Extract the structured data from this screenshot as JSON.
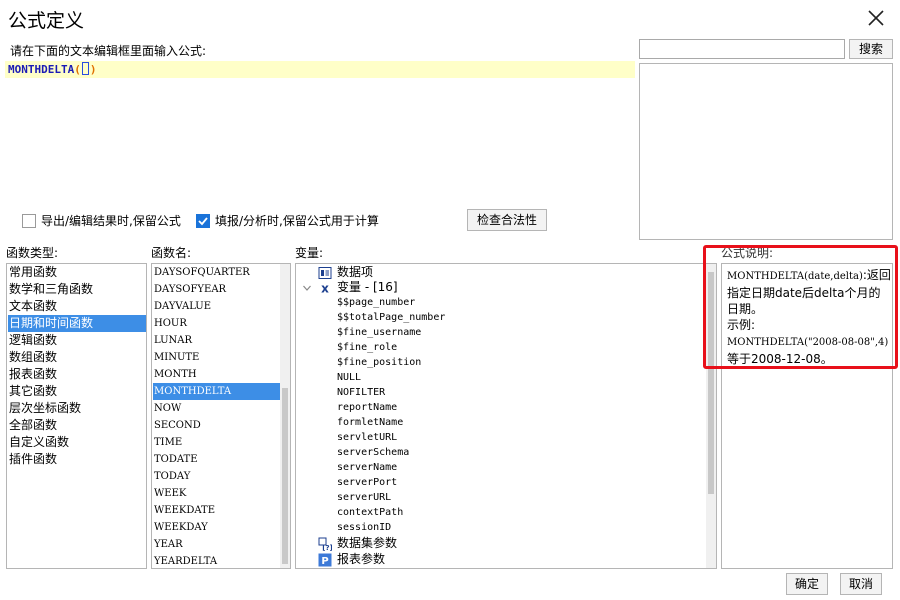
{
  "window": {
    "title": "公式定义"
  },
  "editor": {
    "prompt": "请在下面的文本编辑框里面输入公式:",
    "function_text": "MONTHDELTA",
    "open_paren": "(",
    "close_paren": ")"
  },
  "search": {
    "value": "",
    "button_label": "搜索"
  },
  "options": {
    "export_keep": {
      "label": "导出/编辑结果时,保留公式",
      "checked": false
    },
    "fill_keep": {
      "label": "填报/分析时,保留公式用于计算",
      "checked": true
    },
    "validate_label": "检查合法性"
  },
  "labels": {
    "categories": "函数类型:",
    "functions": "函数名:",
    "variables": "变量:",
    "description": "公式说明:"
  },
  "categories": [
    {
      "label": "常用函数"
    },
    {
      "label": "数学和三角函数"
    },
    {
      "label": "文本函数"
    },
    {
      "label": "日期和时间函数",
      "selected": true
    },
    {
      "label": "逻辑函数"
    },
    {
      "label": "数组函数"
    },
    {
      "label": "报表函数"
    },
    {
      "label": "其它函数"
    },
    {
      "label": "层次坐标函数"
    },
    {
      "label": "全部函数"
    },
    {
      "label": "自定义函数"
    },
    {
      "label": "插件函数"
    }
  ],
  "functions": [
    {
      "label": "DAYSOFQUARTER"
    },
    {
      "label": "DAYSOFYEAR"
    },
    {
      "label": "DAYVALUE"
    },
    {
      "label": "HOUR"
    },
    {
      "label": "LUNAR"
    },
    {
      "label": "MINUTE"
    },
    {
      "label": "MONTH"
    },
    {
      "label": "MONTHDELTA",
      "selected": true
    },
    {
      "label": "NOW"
    },
    {
      "label": "SECOND"
    },
    {
      "label": "TIME"
    },
    {
      "label": "TODATE"
    },
    {
      "label": "TODAY"
    },
    {
      "label": "WEEK"
    },
    {
      "label": "WEEKDATE"
    },
    {
      "label": "WEEKDAY"
    },
    {
      "label": "YEAR"
    },
    {
      "label": "YEARDELTA"
    }
  ],
  "variables": {
    "data_items": "数据项",
    "var_group": "变量 - [16]",
    "items": [
      "$$page_number",
      "$$totalPage_number",
      "$fine_username",
      "$fine_role",
      "$fine_position",
      "NULL",
      "NOFILTER",
      "reportName",
      "formletName",
      "servletURL",
      "serverSchema",
      "serverName",
      "serverPort",
      "serverURL",
      "contextPath",
      "sessionID"
    ],
    "dataset_params": "数据集参数",
    "report_params": "报表参数"
  },
  "description": {
    "signature": "MONTHDELTA(date,delta)",
    "text_1": ":返回指定日期date后delta个月的日期。",
    "example_label": "示例:",
    "example_code": "MONTHDELTA(\"2008-08-08\",4)",
    "example_result": "等于2008-12-08。"
  },
  "footer": {
    "ok_label": "确定",
    "cancel_label": "取消"
  },
  "colors": {
    "selection": "#3d8ee6",
    "highlight_border": "#e8101a",
    "editor_line": "#ffffc8",
    "code_text": "#1b1bb5"
  }
}
